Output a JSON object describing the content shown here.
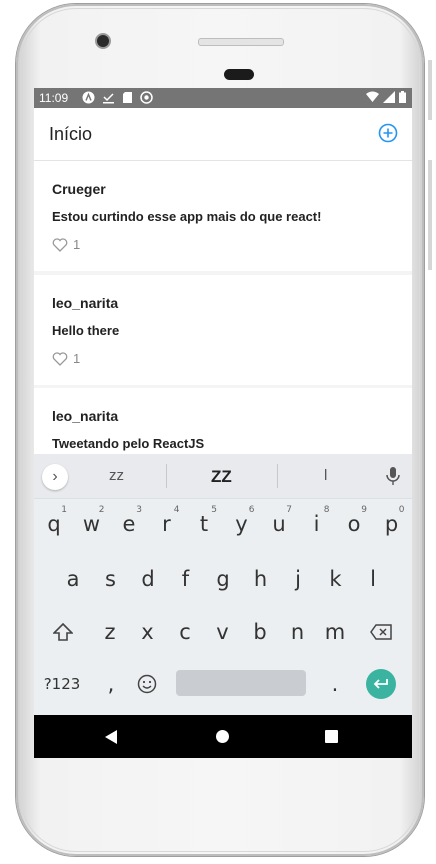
{
  "status_bar": {
    "time": "11:09",
    "left_icons": [
      "a-circle-icon",
      "download-check-icon",
      "sd-card-icon",
      "sync-circle-icon"
    ],
    "right_icons": [
      "wifi-icon",
      "signal-icon",
      "battery-icon"
    ]
  },
  "header": {
    "title": "Início",
    "add_icon": "plus-circle-icon",
    "accent_color": "#2196f3"
  },
  "feed": {
    "tweets": [
      {
        "user": "Crueger",
        "text": "Estou curtindo esse app mais do que react!",
        "likes": "1"
      },
      {
        "user": "leo_narita",
        "text": "Hello there",
        "likes": "1"
      },
      {
        "user": "leo_narita",
        "text": "Tweetando pelo ReactJS",
        "likes": ""
      }
    ]
  },
  "keyboard": {
    "suggestions": [
      "zz",
      "ZZ",
      "l"
    ],
    "row1": [
      {
        "key": "q",
        "hint": "1"
      },
      {
        "key": "w",
        "hint": "2"
      },
      {
        "key": "e",
        "hint": "3"
      },
      {
        "key": "r",
        "hint": "4"
      },
      {
        "key": "t",
        "hint": "5"
      },
      {
        "key": "y",
        "hint": "6"
      },
      {
        "key": "u",
        "hint": "7"
      },
      {
        "key": "i",
        "hint": "8"
      },
      {
        "key": "o",
        "hint": "9"
      },
      {
        "key": "p",
        "hint": "0"
      }
    ],
    "row2": [
      "a",
      "s",
      "d",
      "f",
      "g",
      "h",
      "j",
      "k",
      "l"
    ],
    "row3": [
      "z",
      "x",
      "c",
      "v",
      "b",
      "n",
      "m"
    ],
    "symbols_label": "?123",
    "comma": ",",
    "period": ".",
    "enter_color": "#3bb3a1"
  },
  "nav_bar": {
    "icons": [
      "back-icon",
      "home-icon",
      "recents-icon"
    ]
  }
}
